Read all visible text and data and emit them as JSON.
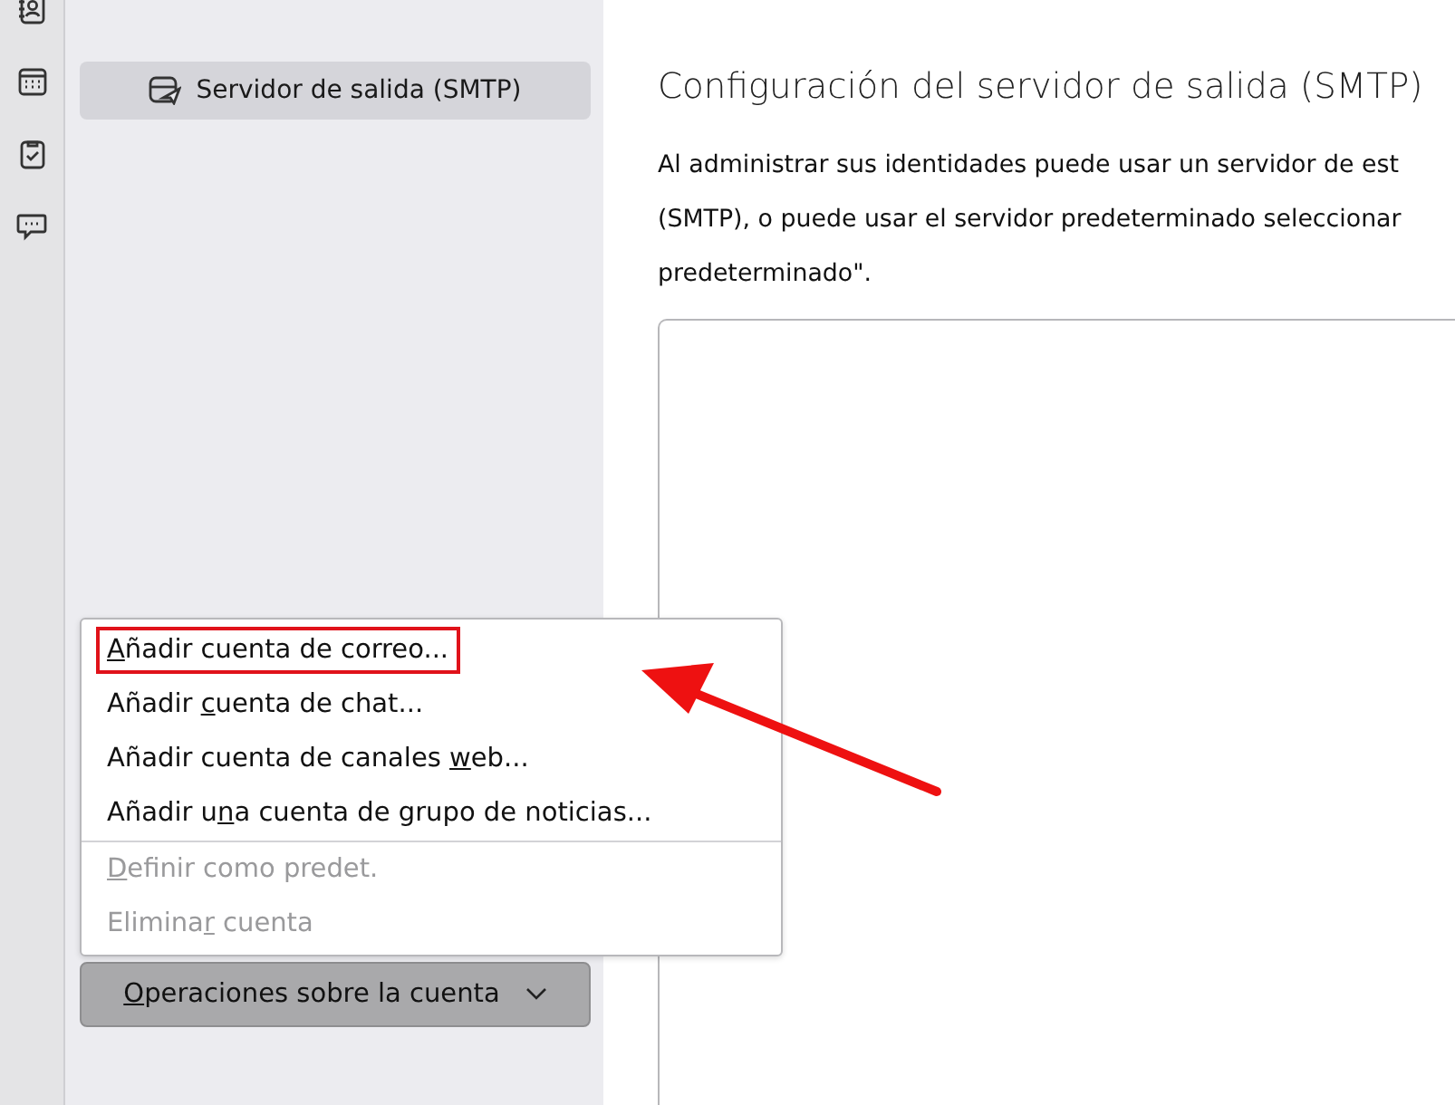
{
  "toolbar": {
    "items": [
      {
        "kind": "contacts"
      },
      {
        "kind": "calendar"
      },
      {
        "kind": "tasks"
      },
      {
        "kind": "chat"
      }
    ]
  },
  "sidebar": {
    "items": [
      {
        "label": "Servidor de salida (SMTP)",
        "selected": true
      }
    ]
  },
  "main": {
    "title": "Configuración del servidor de salida (SMTP)",
    "description_lines": [
      "Al administrar sus identidades puede usar un servidor de est",
      "(SMTP), o puede usar el servidor predeterminado seleccionar",
      "predeterminado\"."
    ]
  },
  "menu": {
    "items": [
      {
        "key": "A",
        "after": "ñadir cuenta de correo...",
        "disabled": false,
        "highlighted": true,
        "separator_after": false
      },
      {
        "before": "Añadir ",
        "key": "c",
        "after": "uenta de chat...",
        "disabled": false,
        "highlighted": false,
        "separator_after": false
      },
      {
        "before": "Añadir cuenta de canales ",
        "key": "w",
        "after": "eb...",
        "disabled": false,
        "highlighted": false,
        "separator_after": false
      },
      {
        "before": "Añadir u",
        "key": "n",
        "after": "a cuenta de grupo de noticias...",
        "disabled": false,
        "highlighted": false,
        "separator_after": true
      },
      {
        "key": "D",
        "after": "efinir como predet.",
        "disabled": true,
        "highlighted": false,
        "separator_after": false
      },
      {
        "before": "Elimina",
        "key": "r",
        "after": " cuenta",
        "disabled": true,
        "highlighted": false,
        "separator_after": false
      }
    ]
  },
  "account_button": {
    "key": "O",
    "after": "peraciones sobre la cuenta"
  }
}
